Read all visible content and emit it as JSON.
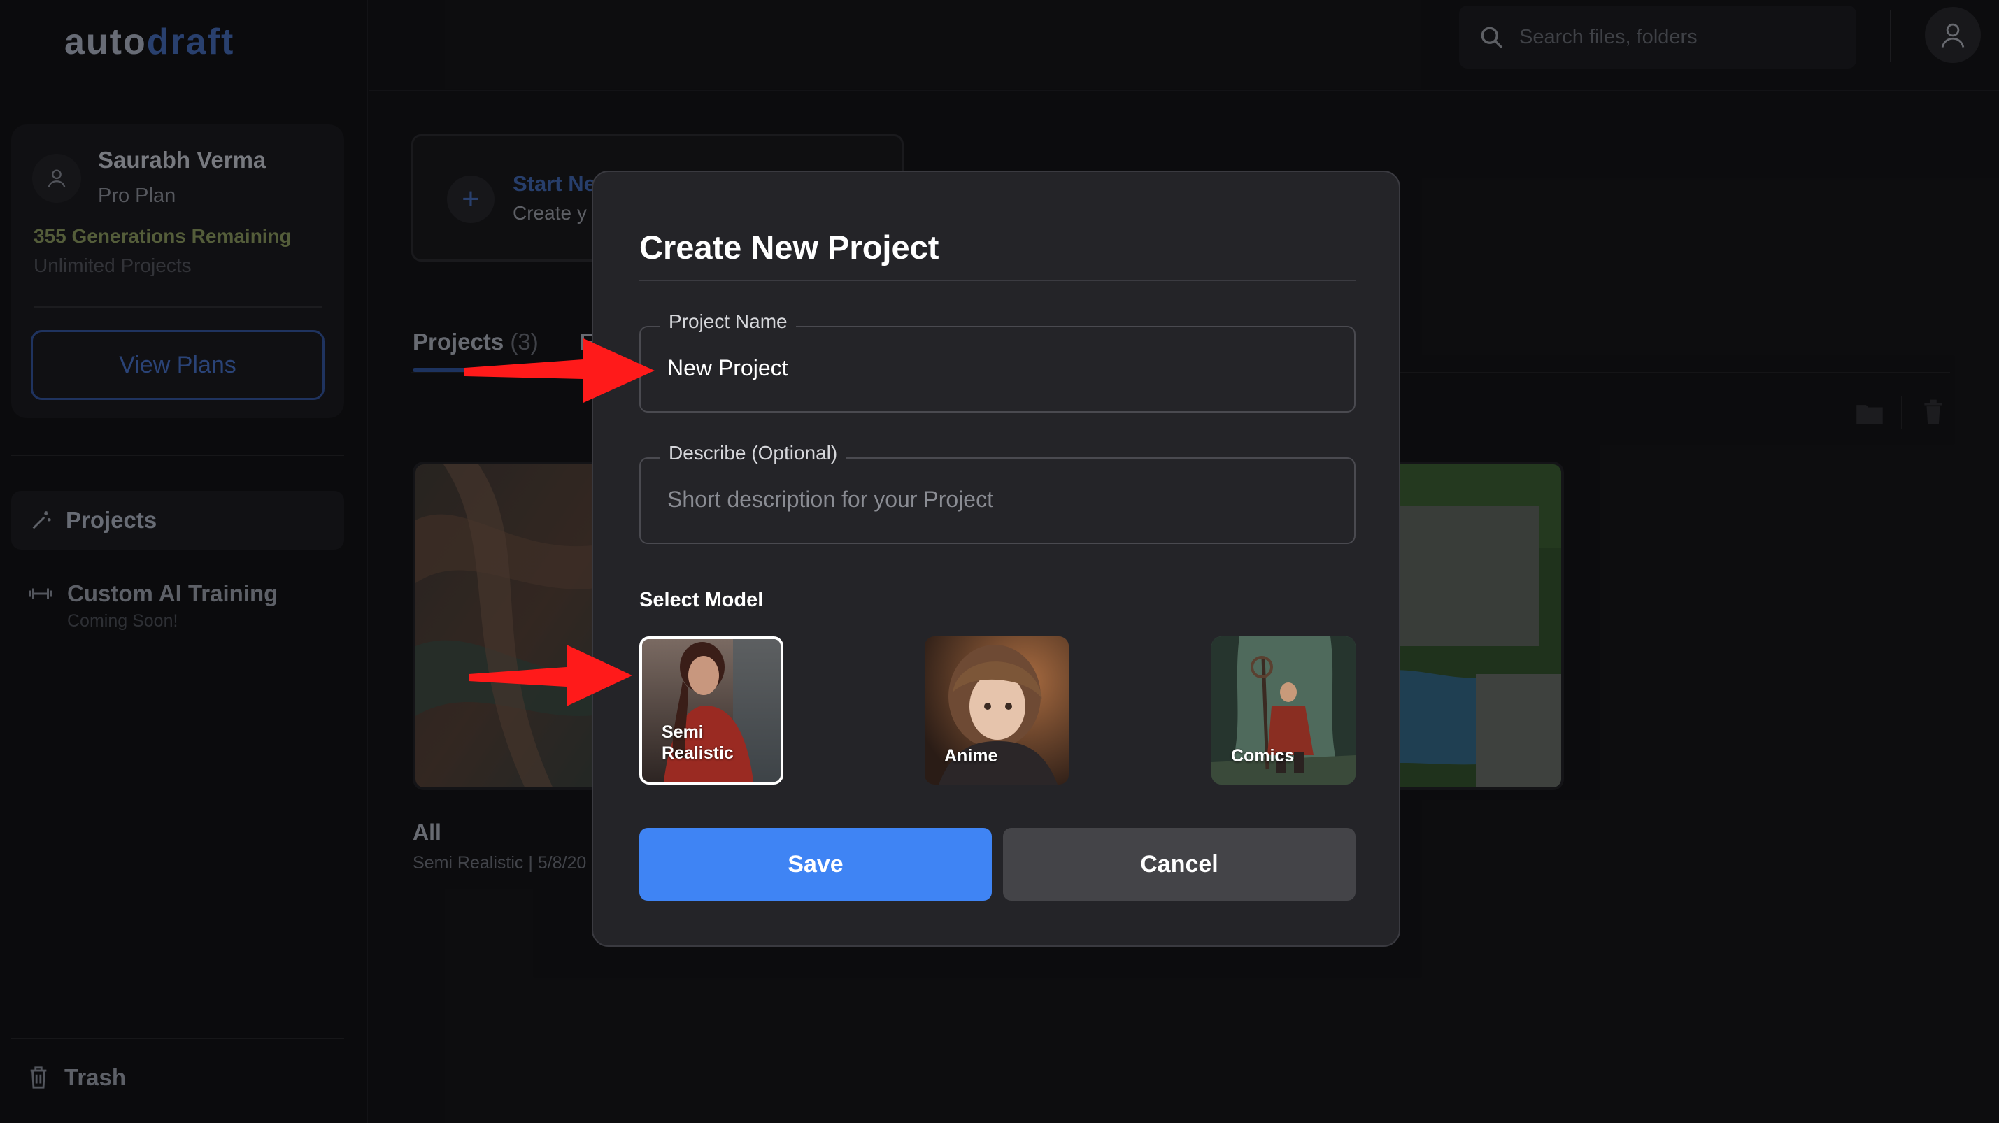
{
  "app": {
    "logo_part1": "auto",
    "logo_part2": "draft"
  },
  "user": {
    "name": "Saurabh Verma",
    "plan": "Pro Plan",
    "generations": "355 Generations Remaining",
    "projects_quota": "Unlimited Projects",
    "view_plans_label": "View Plans"
  },
  "sidebar": {
    "projects_label": "Projects",
    "training_label": "Custom AI Training",
    "training_sub": "Coming Soon!",
    "trash_label": "Trash"
  },
  "header": {
    "search_placeholder": "Search files, folders"
  },
  "main": {
    "start_title": "Start Ne",
    "start_sub": "Create y",
    "tab_projects_label": "Projects",
    "tab_projects_count": "(3)",
    "tab_second_label": "F",
    "project_name": "All",
    "project_meta": "Semi Realistic | 5/8/20"
  },
  "modal": {
    "title": "Create New Project",
    "name_legend": "Project Name",
    "name_value": "New Project",
    "desc_legend": "Describe (Optional)",
    "desc_placeholder": "Short description for your Project",
    "select_model_label": "Select Model",
    "models": [
      {
        "label": "Semi Realistic",
        "selected": true
      },
      {
        "label": "Anime",
        "selected": false
      },
      {
        "label": "Comics",
        "selected": false
      }
    ],
    "save_label": "Save",
    "cancel_label": "Cancel"
  },
  "colors": {
    "accent": "#3f84f4",
    "arrow": "#ff1a1a",
    "modal_bg": "#242428"
  }
}
